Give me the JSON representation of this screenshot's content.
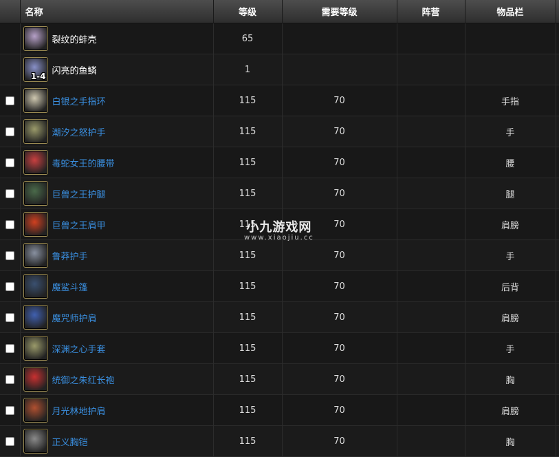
{
  "headers": {
    "name": "名称",
    "level": "等级",
    "req_level": "需要等级",
    "faction": "阵营",
    "slot": "物品栏"
  },
  "rows": [
    {
      "name": "裂纹的蚌壳",
      "level": "65",
      "req": "",
      "faction": "",
      "slot": "",
      "check": false,
      "style": "plain",
      "icon": "cracked-clam-icon",
      "icon_color": "#b6a0c8"
    },
    {
      "name": "闪亮的鱼鳞",
      "level": "1",
      "req": "",
      "faction": "",
      "slot": "",
      "check": false,
      "style": "plain",
      "icon": "shiny-fish-scales-icon",
      "icon_color": "#8890c8",
      "qty": "1-4"
    },
    {
      "name": "白银之手指环",
      "level": "115",
      "req": "70",
      "faction": "",
      "slot": "手指",
      "check": true,
      "style": "link",
      "icon": "silver-hand-ring-icon",
      "icon_color": "#cfc8b0"
    },
    {
      "name": "潮汐之怒护手",
      "level": "115",
      "req": "70",
      "faction": "",
      "slot": "手",
      "check": true,
      "style": "link",
      "icon": "tidal-fury-gauntlets-icon",
      "icon_color": "#9a9a6a"
    },
    {
      "name": "毒蛇女王的腰带",
      "level": "115",
      "req": "70",
      "faction": "",
      "slot": "腰",
      "check": true,
      "style": "link",
      "icon": "serpent-queen-belt-icon",
      "icon_color": "#c84040"
    },
    {
      "name": "巨兽之王护腿",
      "level": "115",
      "req": "70",
      "faction": "",
      "slot": "腿",
      "check": true,
      "style": "link",
      "icon": "beast-king-legguards-icon",
      "icon_color": "#4a6a4a"
    },
    {
      "name": "巨兽之王肩甲",
      "level": "115",
      "req": "70",
      "faction": "",
      "slot": "肩膀",
      "check": true,
      "style": "link",
      "icon": "beast-king-pauldrons-icon",
      "icon_color": "#d04020"
    },
    {
      "name": "鲁莽护手",
      "level": "115",
      "req": "70",
      "faction": "",
      "slot": "手",
      "check": true,
      "style": "link",
      "icon": "reckless-gauntlets-icon",
      "icon_color": "#8890a0"
    },
    {
      "name": "魔鲨斗篷",
      "level": "115",
      "req": "70",
      "faction": "",
      "slot": "后背",
      "check": true,
      "style": "link",
      "icon": "demon-shark-cloak-icon",
      "icon_color": "#3a5070"
    },
    {
      "name": "魔咒师护肩",
      "level": "115",
      "req": "70",
      "faction": "",
      "slot": "肩膀",
      "check": true,
      "style": "link",
      "icon": "spellcaster-shoulders-icon",
      "icon_color": "#4060b0"
    },
    {
      "name": "深渊之心手套",
      "level": "115",
      "req": "70",
      "faction": "",
      "slot": "手",
      "check": true,
      "style": "link",
      "icon": "abyss-heart-gloves-icon",
      "icon_color": "#9a9a6a"
    },
    {
      "name": "统御之朱红长袍",
      "level": "115",
      "req": "70",
      "faction": "",
      "slot": "胸",
      "check": true,
      "style": "link",
      "icon": "crimson-robe-icon",
      "icon_color": "#c83030"
    },
    {
      "name": "月光林地护肩",
      "level": "115",
      "req": "70",
      "faction": "",
      "slot": "肩膀",
      "check": true,
      "style": "link",
      "icon": "moonglade-shoulders-icon",
      "icon_color": "#b05030"
    },
    {
      "name": "正义胸铠",
      "level": "115",
      "req": "70",
      "faction": "",
      "slot": "胸",
      "check": true,
      "style": "link",
      "icon": "justice-breastplate-icon",
      "icon_color": "#8a8a8a"
    }
  ],
  "watermark": {
    "title": "小九游戏网",
    "url": "www.xiaojiu.cc"
  }
}
